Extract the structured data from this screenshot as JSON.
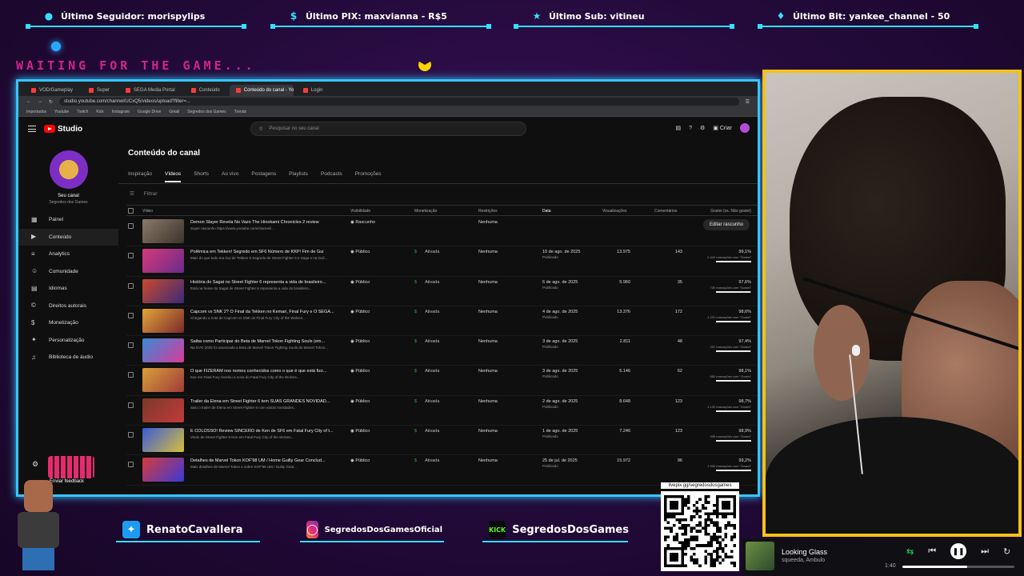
{
  "overlay": {
    "top_bars": [
      {
        "icon": "user-icon",
        "text": "Último Seguidor: morispylips"
      },
      {
        "icon": "dollar-icon",
        "text": "Último PIX: maxvianna - R$5"
      },
      {
        "icon": "star-icon",
        "text": "Último Sub: vitineu"
      },
      {
        "icon": "diamond-icon",
        "text": "Último Bit: yankee_channel - 50"
      }
    ],
    "waiting_text": "WAITING FOR THE GAME...",
    "socials": [
      {
        "icon": "twitter-icon",
        "text": "RenatoCavallera"
      },
      {
        "icon": "instagram-icon",
        "text": "SegredosDosGamesOficial"
      },
      {
        "icon": "kick-icon",
        "text": "SegredosDosGames",
        "badge": "KICK"
      }
    ],
    "qr_label": "livepix.gg/segredosdosgames",
    "feedback": "Enviar feedback",
    "accent_color": "#34e0ff",
    "cam_border_color": "#f2c21a"
  },
  "player": {
    "title": "Looking Glass",
    "artist": "squeeda, Ambulo",
    "time": "1:40",
    "progress": 0.58
  },
  "browser": {
    "tabs": [
      "VOD/Gameplay",
      "Super",
      "SEGA Media Portal",
      "Conteúdo",
      "Conteúdo do canal - YouTube Studio",
      "Login"
    ],
    "url": "studio.youtube.com/channel/UCxQ5/videos/upload?filter=...",
    "bookmarks": [
      "Importados",
      "Youtube",
      "Twitch",
      "Kick",
      "Instagram",
      "Google Drive",
      "Gmail",
      "Segredos dos Games",
      "Trends"
    ]
  },
  "studio": {
    "logo_text": "Studio",
    "search_placeholder": "Pesquisar no seu canal",
    "create_label": "Criar",
    "channel_label": "Seu canal",
    "channel_name": "Segredos dos Games",
    "sidebar": [
      {
        "icon": "dashboard-icon",
        "label": "Painel"
      },
      {
        "icon": "content-icon",
        "label": "Conteúdo",
        "active": true
      },
      {
        "icon": "analytics-icon",
        "label": "Analytics"
      },
      {
        "icon": "community-icon",
        "label": "Comunidade"
      },
      {
        "icon": "subtitles-icon",
        "label": "Idiomas"
      },
      {
        "icon": "copyright-icon",
        "label": "Direitos autorais"
      },
      {
        "icon": "monetization-icon",
        "label": "Monetização"
      },
      {
        "icon": "customization-icon",
        "label": "Personalização"
      },
      {
        "icon": "audio-library-icon",
        "label": "Biblioteca de áudio"
      }
    ],
    "page_title": "Conteúdo do canal",
    "content_tabs": [
      "Inspiração",
      "Vídeos",
      "Shorts",
      "Ao vivo",
      "Postagens",
      "Playlists",
      "Podcasts",
      "Promoções"
    ],
    "active_tab": "Vídeos",
    "filter_label": "Filtrar",
    "columns": [
      "Vídeo",
      "Visibilidade",
      "Monetização",
      "Restrições",
      "Data",
      "Visualizações",
      "Comentários",
      "Gostei (vs. Não gostei)"
    ],
    "edit_draft_label": "Editar rascunho",
    "rows": [
      {
        "title": "Demon Slayer Revela No Vazo The Hinokami Chronicles 2 review",
        "desc": "Super rascunho https://www.youtube.com/channel/...",
        "visibility": "Rascunho",
        "monetization": "",
        "restrictions": "Nenhuma",
        "date": "",
        "date_sub": "",
        "views": "",
        "comments": "",
        "like": "",
        "like_sub": "",
        "like_pct": 0,
        "draft": true,
        "thumb": [
          "#8a7a6a",
          "#3c332c"
        ]
      },
      {
        "title": "Polêmica em Tekken! Segredo em SF6 Número de KKP! Fim de Gui",
        "desc": "Mais do que tudo era Gui de Tekken 8 Segredo de Street Fighter 6 e Saga e na Guil...",
        "visibility": "Público",
        "monetization": "Ativada",
        "restrictions": "Nenhuma",
        "date": "10 de ago. de 2025",
        "date_sub": "Publicado",
        "views": "13.975",
        "comments": "143",
        "like": "99,1%",
        "like_sub": "2.442 marcações com \"Gostei\"",
        "like_pct": 0.99,
        "thumb": [
          "#d53a7a",
          "#6a2b8a"
        ]
      },
      {
        "title": "História do Sagat no Street Fighter 6 representa a vida de brasileiro...",
        "desc": "Está na frente do Sagat de Street Fighter 6 representa a vida do brasileiro...",
        "visibility": "Público",
        "monetization": "Ativada",
        "restrictions": "Nenhuma",
        "date": "6 de ago. de 2025",
        "date_sub": "Publicado",
        "views": "5.960",
        "comments": "35",
        "like": "97,6%",
        "like_sub": "730 marcações com \"Gostei\"",
        "like_pct": 0.976,
        "thumb": [
          "#c94a2a",
          "#3a2a7a"
        ]
      },
      {
        "title": "Capcom vs SNK 2? O Final da Tekken no Kemari, Final Fury e O SEGA...",
        "desc": "Chegando a nota de Capcom vs SNK do Final Fury City of the Wolves...",
        "visibility": "Público",
        "monetization": "Ativada",
        "restrictions": "Nenhuma",
        "date": "4 de ago. de 2025",
        "date_sub": "Publicado",
        "views": "13.376",
        "comments": "172",
        "like": "98,6%",
        "like_sub": "1.231 marcações com \"Gostei\"",
        "like_pct": 0.986,
        "thumb": [
          "#e3a43a",
          "#7a2a2a"
        ]
      },
      {
        "title": "Saiba como Participar do Beta de Marvel Tokon Fighting Souls (em...",
        "desc": "Na EVO 2025 foi anunciada a Beta de Marvel Tokon Fighting Souls do Marvel Tokon...",
        "visibility": "Público",
        "monetization": "Ativada",
        "restrictions": "Nenhuma",
        "date": "3 de ago. de 2025",
        "date_sub": "Publicado",
        "views": "2.811",
        "comments": "48",
        "like": "97,4%",
        "like_sub": "297 marcações com \"Gostei\"",
        "like_pct": 0.974,
        "thumb": [
          "#3a8ad8",
          "#d83a9a"
        ]
      },
      {
        "title": "O que FIZERAM nos nomes conhecidos como o que é que está fizz...",
        "desc": "Kaz em Fatal Fury revelou a nova do Fatal Fury City of the Wolves...",
        "visibility": "Público",
        "monetization": "Ativada",
        "restrictions": "Nenhuma",
        "date": "3 de ago. de 2025",
        "date_sub": "Publicado",
        "views": "5.146",
        "comments": "62",
        "like": "98,1%",
        "like_sub": "660 marcações com \"Gostei\"",
        "like_pct": 0.981,
        "thumb": [
          "#d8a03a",
          "#a03a3a"
        ]
      },
      {
        "title": "Trailer da Elena em Street Fighter 6 tem SUAS GRANDES NOVIDAD...",
        "desc": "Saiu o trailer de Elena em Street Fighter 6 com várias novidades...",
        "visibility": "Público",
        "monetization": "Ativada",
        "restrictions": "Nenhuma",
        "date": "2 de ago. de 2025",
        "date_sub": "Publicado",
        "views": "8.648",
        "comments": "123",
        "like": "98,7%",
        "like_sub": "1.132 marcações com \"Gostei\"",
        "like_pct": 0.987,
        "thumb": [
          "#7a3a2a",
          "#c23a3a"
        ]
      },
      {
        "title": "É COLOSSO! Review SINCERO de Ken de SF6 em Fatal Fury City of t...",
        "desc": "Vindo de Street Fighter 6 Ken em Fatal Fury City of the Wolves...",
        "visibility": "Público",
        "monetization": "Ativada",
        "restrictions": "Nenhuma",
        "date": "1 de ago. de 2025",
        "date_sub": "Publicado",
        "views": "7.246",
        "comments": "123",
        "like": "98,9%",
        "like_sub": "939 marcações com \"Gostei\"",
        "like_pct": 0.989,
        "thumb": [
          "#3a5ad8",
          "#d8c03a"
        ]
      },
      {
        "title": "Detalhes de Marvel Tokon KOF'98 UM / Home Guilty Gear Conclud...",
        "desc": "Mais detalhes de Marvel Tokon e sobre KOF'98 UM / Guilty Gear...",
        "visibility": "Público",
        "monetization": "Ativada",
        "restrictions": "Nenhuma",
        "date": "25 de jul. de 2025",
        "date_sub": "Publicado",
        "views": "15.972",
        "comments": "96",
        "like": "99,2%",
        "like_sub": "1.990 marcações com \"Gostei\"",
        "like_pct": 0.992,
        "thumb": [
          "#d83a3a",
          "#3a3ad8"
        ]
      }
    ]
  }
}
